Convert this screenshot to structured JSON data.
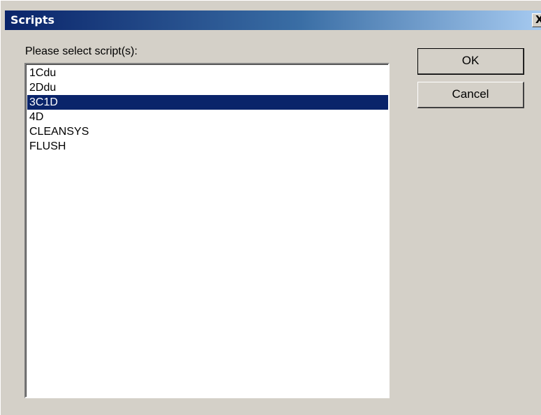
{
  "window": {
    "title": "Scripts",
    "close_label": "X"
  },
  "prompt": "Please select script(s):",
  "scripts": [
    {
      "label": "1Cdu",
      "selected": false
    },
    {
      "label": "2Ddu",
      "selected": false
    },
    {
      "label": "3C1D",
      "selected": true
    },
    {
      "label": "4D",
      "selected": false
    },
    {
      "label": "CLEANSYS",
      "selected": false
    },
    {
      "label": "FLUSH",
      "selected": false
    }
  ],
  "buttons": {
    "ok_label": "OK",
    "cancel_label": "Cancel"
  },
  "colors": {
    "selection": "#0a246a",
    "titlebar_start": "#0a246a",
    "titlebar_end": "#a6caf0",
    "face": "#d4d0c8"
  }
}
